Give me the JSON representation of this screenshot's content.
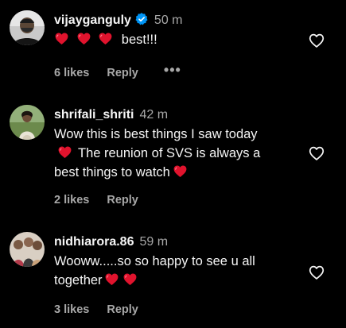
{
  "comments": [
    {
      "username": "vijayganguly",
      "verified": true,
      "time": "50 m",
      "text_before": "",
      "text_after": "best!!!",
      "likes": "6 likes",
      "reply": "Reply",
      "more": "•••"
    },
    {
      "username": "shrifali_shriti",
      "verified": false,
      "time": "42 m",
      "line1": "Wow this is best things I saw today",
      "line2": "The reunion of SVS is always a",
      "line3": "best things to watch",
      "likes": "2 likes",
      "reply": "Reply"
    },
    {
      "username": "nidhiarora.86",
      "verified": false,
      "time": "59 m",
      "line1": "Wooww.....so so happy to see u all",
      "line2": "together",
      "likes": "3 likes",
      "reply": "Reply"
    }
  ],
  "colors": {
    "background": "#000000",
    "text": "#f5f5f5",
    "muted": "#a8a8a8",
    "heart": "#e0132d",
    "verified": "#0095f6"
  },
  "icons": [
    "heart-emoji",
    "verified-badge-icon",
    "like-heart-icon",
    "more-options-icon"
  ]
}
